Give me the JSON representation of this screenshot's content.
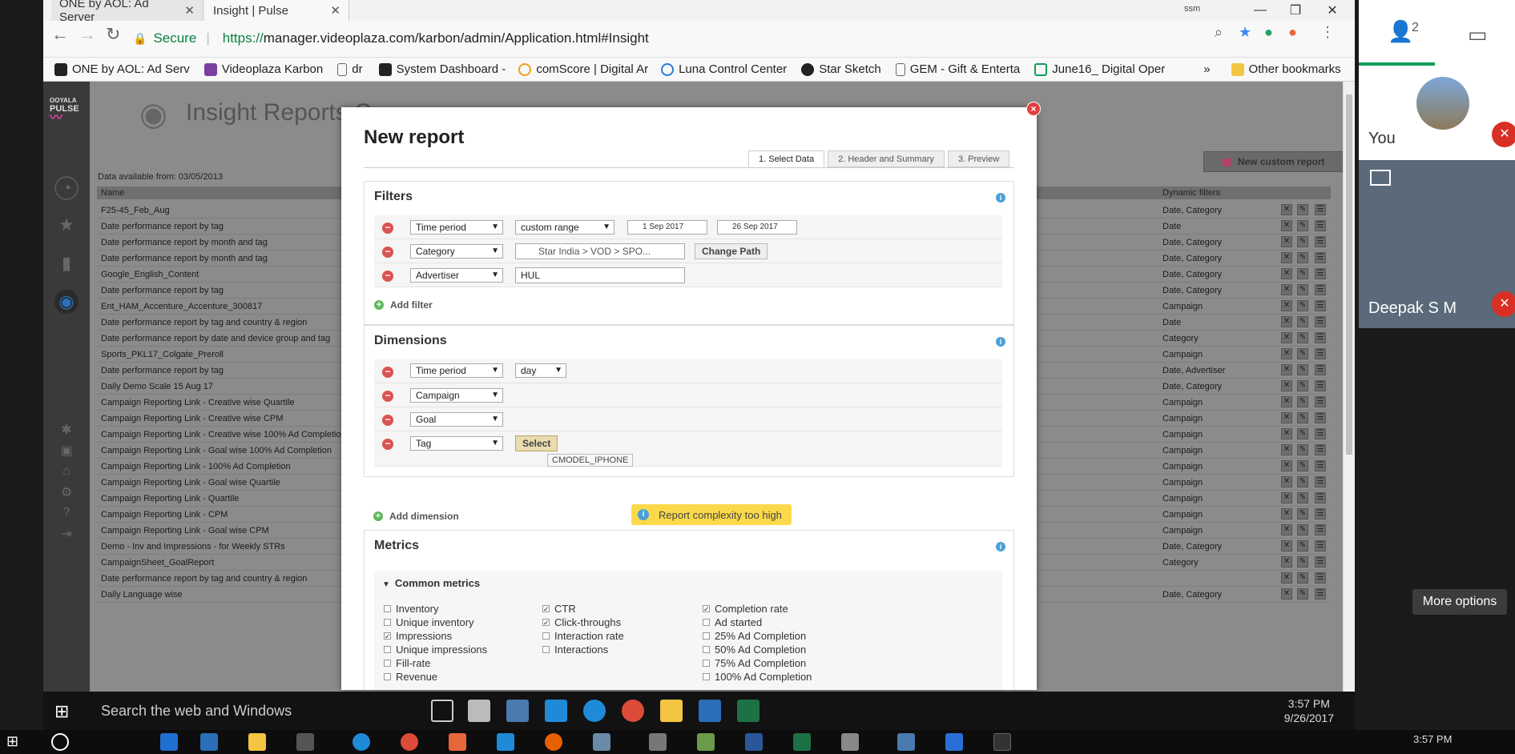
{
  "browser": {
    "tabs": [
      {
        "label": "ONE by AOL: Ad Server",
        "close": "✕"
      },
      {
        "label": "Insight | Pulse",
        "close": "✕"
      }
    ],
    "user_badge": "ssm",
    "secure_label": "Secure",
    "url_scheme": "https://",
    "url_rest": "manager.videoplaza.com/karbon/admin/Application.html#Insight",
    "bookmarks": [
      "ONE by AOL: Ad Serv",
      "Videoplaza Karbon",
      "dr",
      "System Dashboard -",
      "comScore | Digital Ar",
      "Luna Control Center",
      "Star Sketch",
      "GEM - Gift & Enterta",
      "June16_ Digital Oper"
    ],
    "bookmarks_more": "»",
    "other_bookmarks": "Other bookmarks"
  },
  "app": {
    "logo_line1": "OOYALA",
    "logo_line2": "PULSE",
    "page_title": "Insight Reports C",
    "data_available": "Data available from: 03/05/2013",
    "new_custom_report": "New custom report",
    "table": {
      "col_name": "Name",
      "col_dynamic": "Dynamic filters",
      "rows": [
        {
          "name": "F25-45_Feb_Aug",
          "dyn": "Date, Category"
        },
        {
          "name": "Date performance report by tag",
          "dyn": "Date"
        },
        {
          "name": "Date performance report by month and tag",
          "dyn": "Date, Category"
        },
        {
          "name": "Date performance report by month and tag",
          "dyn": "Date, Category"
        },
        {
          "name": "Google_English_Content",
          "dyn": "Date, Category"
        },
        {
          "name": "Date performance report by tag",
          "dyn": "Date, Category"
        },
        {
          "name": "Ent_HAM_Accenture_Accenture_300817",
          "dyn": "Campaign"
        },
        {
          "name": "Date performance report by tag and country & region",
          "dyn": "Date"
        },
        {
          "name": "Date performance report by date and device group and tag",
          "dyn": "Category"
        },
        {
          "name": "Sports_PKL17_Colgate_Preroll",
          "dyn": "Campaign"
        },
        {
          "name": "Date performance report by tag",
          "dyn": "Date, Advertiser"
        },
        {
          "name": "Daily Demo Scale 15 Aug 17",
          "dyn": "Date, Category"
        },
        {
          "name": "Campaign Reporting Link - Creative wise Quartile",
          "dyn": "Campaign"
        },
        {
          "name": "Campaign Reporting Link - Creative wise CPM",
          "dyn": "Campaign"
        },
        {
          "name": "Campaign Reporting Link - Creative wise 100% Ad Completion",
          "dyn": "Campaign"
        },
        {
          "name": "Campaign Reporting Link - Goal wise 100% Ad Completion",
          "dyn": "Campaign"
        },
        {
          "name": "Campaign Reporting Link - 100% Ad Completion",
          "dyn": "Campaign"
        },
        {
          "name": "Campaign Reporting Link - Goal wise Quartile",
          "dyn": "Campaign"
        },
        {
          "name": "Campaign Reporting Link - Quartile",
          "dyn": "Campaign"
        },
        {
          "name": "Campaign Reporting Link - CPM",
          "dyn": "Campaign"
        },
        {
          "name": "Campaign Reporting Link - Goal wise CPM",
          "dyn": "Campaign"
        },
        {
          "name": "Demo - Inv and Impressions - for Weekly STRs",
          "dyn": "Date, Category"
        },
        {
          "name": "CampaignSheet_GoalReport",
          "dyn": "Category"
        },
        {
          "name": "Date performance report by tag and country & region",
          "dyn": ""
        },
        {
          "name": "Daily Language wise",
          "dyn": "Date, Category"
        }
      ]
    }
  },
  "modal": {
    "title": "New report",
    "close": "×",
    "steps": [
      "1. Select Data",
      "2. Header and Summary",
      "3. Preview"
    ],
    "filters": {
      "title": "Filters",
      "rows": [
        {
          "field": "Time period",
          "op": "custom range",
          "from": "1 Sep 2017",
          "to": "26 Sep 2017"
        },
        {
          "field": "Category",
          "value": "Star India > VOD > SPO...",
          "button": "Change Path"
        },
        {
          "field": "Advertiser",
          "value": "HUL"
        }
      ],
      "add": "Add filter"
    },
    "dimensions": {
      "title": "Dimensions",
      "rows": [
        {
          "field": "Time period",
          "op": "day"
        },
        {
          "field": "Campaign"
        },
        {
          "field": "Goal"
        },
        {
          "field": "Tag",
          "button": "Select",
          "chip": "CMODEL_IPHONE"
        }
      ],
      "add": "Add dimension",
      "warning": "Report complexity too high"
    },
    "metrics": {
      "title": "Metrics",
      "group": "Common metrics",
      "col1": [
        {
          "label": "Inventory",
          "checked": false
        },
        {
          "label": "Unique inventory",
          "checked": false
        },
        {
          "label": "Impressions",
          "checked": true
        },
        {
          "label": "Unique impressions",
          "checked": false
        },
        {
          "label": "Fill-rate",
          "checked": false
        },
        {
          "label": "Revenue",
          "checked": false
        }
      ],
      "col2": [
        {
          "label": "CTR",
          "checked": true
        },
        {
          "label": "Click-throughs",
          "checked": true
        },
        {
          "label": "Interaction rate",
          "checked": false
        },
        {
          "label": "Interactions",
          "checked": false
        }
      ],
      "col3": [
        {
          "label": "Completion rate",
          "checked": true
        },
        {
          "label": "Ad started",
          "checked": false
        },
        {
          "label": "25% Ad Completion",
          "checked": false
        },
        {
          "label": "50% Ad Completion",
          "checked": false
        },
        {
          "label": "75% Ad Completion",
          "checked": false
        },
        {
          "label": "100% Ad Completion",
          "checked": false
        }
      ]
    }
  },
  "taskbar": {
    "search": "Search the web and Windows",
    "time": "3:57 PM",
    "date": "9/26/2017",
    "outer_time": "3:57 PM"
  },
  "side_panel": {
    "participants": "2",
    "you_label": "You",
    "deepak_label": "Deepak S M",
    "more_options": "More options"
  }
}
